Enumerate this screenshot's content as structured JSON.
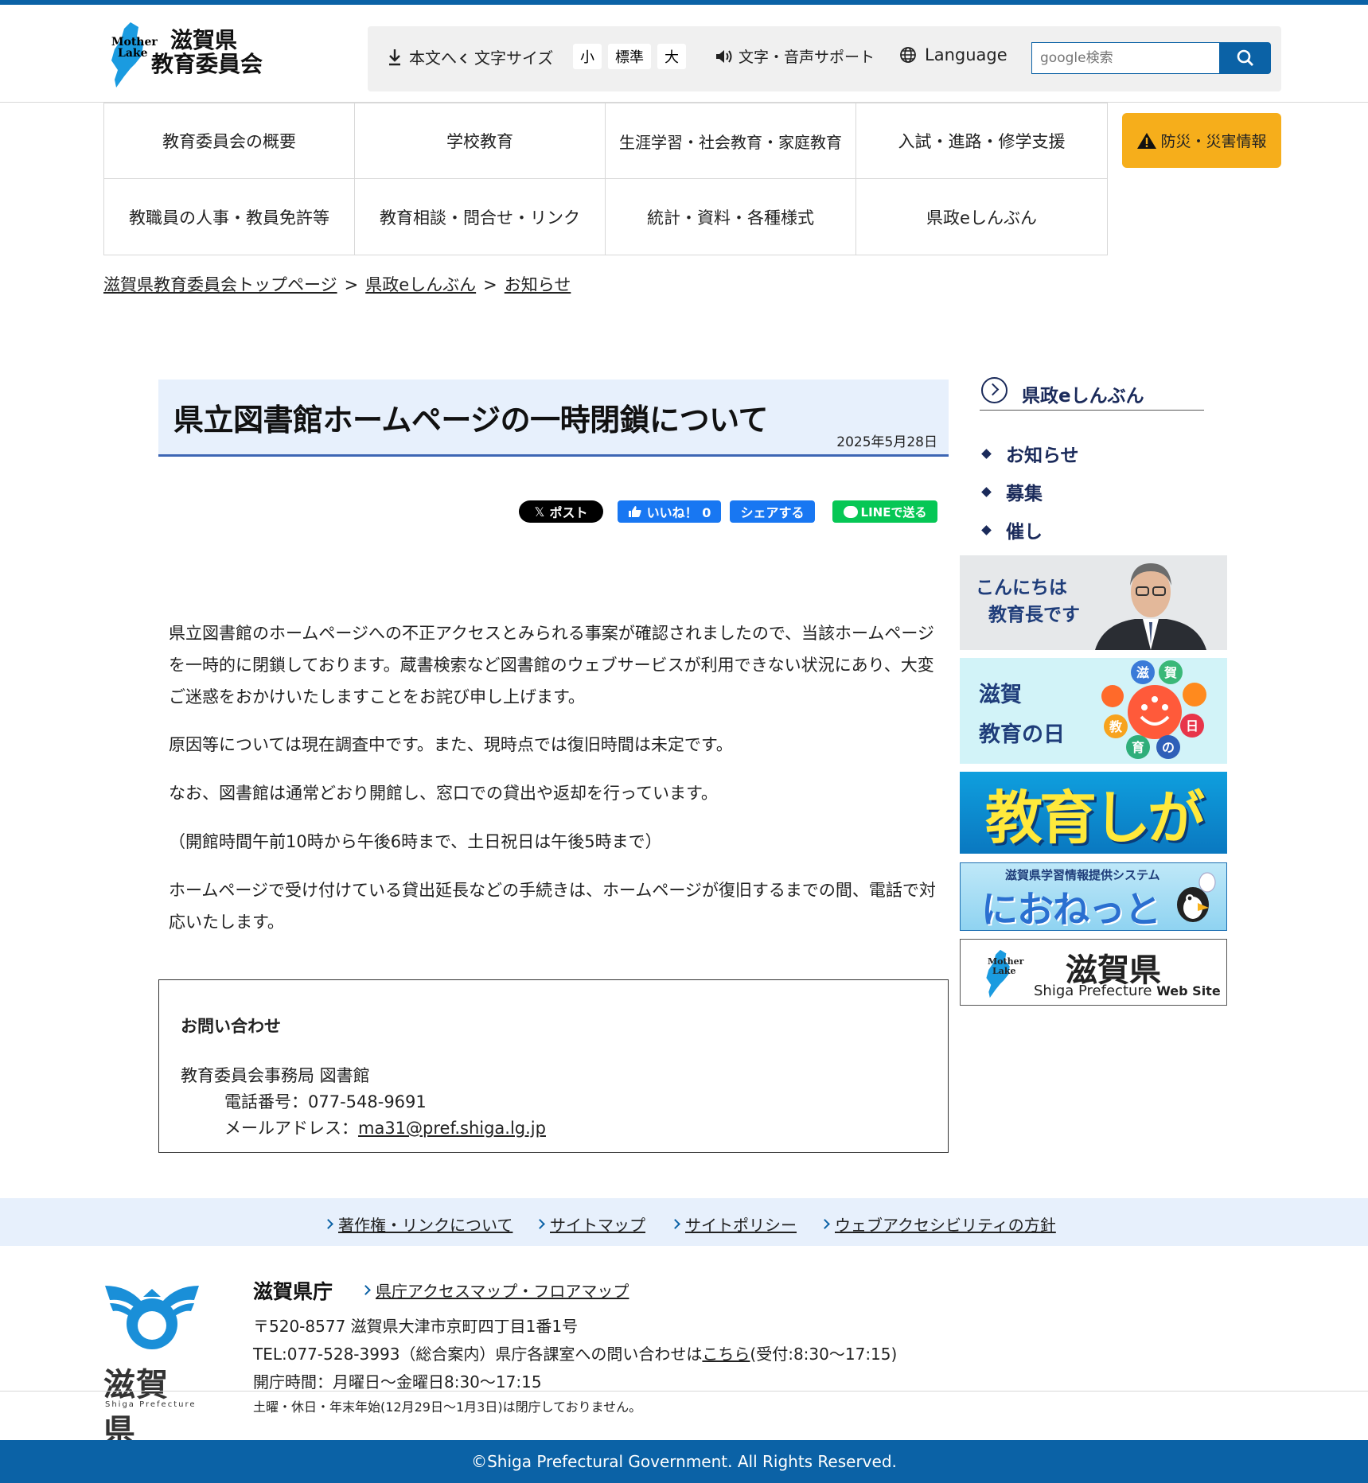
{
  "header": {
    "logo_mother": "Mother",
    "logo_lake": "Lake",
    "logo_line1": "滋賀県",
    "logo_line2": "教育委員会",
    "skip_label": "本文へ",
    "font_size_label": "文字サイズ",
    "font_small": "小",
    "font_standard": "標準",
    "font_large": "大",
    "voice_support": "文字・音声サポート",
    "language": "Language",
    "search_placeholder": "google検索"
  },
  "nav": {
    "items": [
      "教育委員会の概要",
      "学校教育",
      "生涯学習・社会教育・家庭教育",
      "入試・進路・修学支援",
      "教職員の人事・教員免許等",
      "教育相談・問合せ・リンク",
      "統計・資料・各種様式",
      "県政eしんぶん"
    ],
    "disaster": "防災・災害情報"
  },
  "breadcrumb": {
    "items": [
      "滋賀県教育委員会トップページ",
      "県政eしんぶん",
      "お知らせ"
    ],
    "separator": ">"
  },
  "article": {
    "title": "県立図書館ホームページの一時閉鎖について",
    "date": "2025年5月28日",
    "share": {
      "post": "ポスト",
      "like": "いいね！ 0",
      "fb_share": "シェアする",
      "line": "LINEで送る"
    },
    "paragraphs": [
      "県立図書館のホームページへの不正アクセスとみられる事案が確認されましたので、当該ホームページを一時的に閉鎖しております。蔵書検索など図書館のウェブサービスが利用できない状況にあり、大変ご迷惑をおかけいたしますことをお詫び申し上げます。",
      "原因等については現在調査中です。また、現時点では復旧時間は未定です。",
      "なお、図書館は通常どおり開館し、窓口での貸出や返却を行っています。",
      "（開館時間午前10時から午後6時まで、土日祝日は午後5時まで）",
      "ホームページで受け付けている貸出延長などの手続きは、ホームページが復旧するまでの間、電話で対応いたします。"
    ],
    "contact": {
      "heading": "お問い合わせ",
      "dept": "教育委員会事務局 図書館",
      "tel": "電話番号：077-548-9691",
      "mail_label": "メールアドレス：",
      "mail": "ma31@pref.shiga.lg.jp"
    }
  },
  "sidebar": {
    "heading": "県政eしんぶん",
    "items": [
      "お知らせ",
      "募集",
      "催し"
    ],
    "banners": {
      "superintendent_line1": "こんにちは",
      "superintendent_line2": "教育長です",
      "eduday_line1": "滋賀",
      "eduday_line2": "教育の日",
      "eduday_chars": [
        "滋",
        "賀",
        "日",
        "の",
        "育",
        "教"
      ],
      "kyoiku": "教育しが",
      "nionet_small": "滋賀県学習情報提供システム",
      "nionet": "におねっと",
      "pref_mother": "Mother",
      "pref_lake": "Lake",
      "pref_name": "滋賀県",
      "pref_en": "Shiga Prefecture",
      "pref_web": "Web Site"
    }
  },
  "footer": {
    "links": [
      "著作権・リンクについて",
      "サイトマップ",
      "サイトポリシー",
      "ウェブアクセシビリティの方針"
    ],
    "emblem_text": "滋賀県",
    "emblem_en": "Shiga Prefecture",
    "office_name": "滋賀県庁",
    "office_map": "県庁アクセスマップ・フロアマップ",
    "address": "〒520-8577 滋賀県大津市京町四丁目1番1号",
    "tel_prefix": "TEL:077-528-3993（総合案内）県庁各課室への問い合わせは",
    "tel_link": "こちら",
    "tel_suffix": "(受付:8:30～17:15)",
    "hours": "開庁時間：月曜日～金曜日8:30～17:15",
    "closed": "土曜・休日・年末年始(12月29日～1月3日)は閉庁しておりません。",
    "copyright": "©Shiga Prefectural Government. All Rights Reserved."
  },
  "colors": {
    "brand_blue": "#0b62a6",
    "disaster_orange": "#f6ae1b",
    "title_bg": "#e7f0fc",
    "navy": "#1a2a5a",
    "x_black": "#000000",
    "fb_blue": "#1877f2",
    "line_green": "#06c755"
  },
  "icons": {
    "skip": "download-arrow-icon",
    "voice": "speaker-icon",
    "language": "globe-icon",
    "search": "magnifier-icon",
    "disaster": "warning-icon"
  }
}
